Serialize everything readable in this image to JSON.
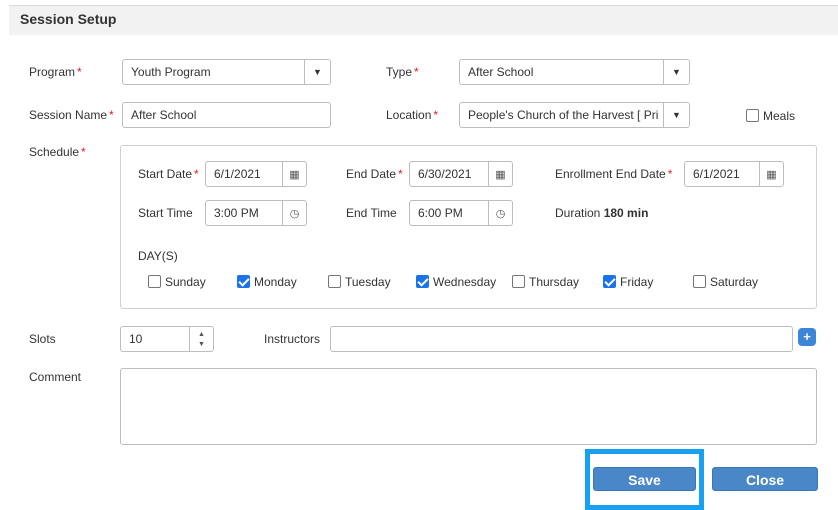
{
  "header": {
    "title": "Session Setup"
  },
  "form": {
    "program": {
      "label": "Program",
      "value": "Youth Program"
    },
    "type": {
      "label": "Type",
      "value": "After School"
    },
    "session_name": {
      "label": "Session Name",
      "value": "After School"
    },
    "location": {
      "label": "Location",
      "value": "People's Church of the Harvest [ Pri"
    },
    "meals": {
      "label": "Meals",
      "checked": false
    },
    "schedule": {
      "label": "Schedule",
      "start_date": {
        "label": "Start Date",
        "value": "6/1/2021"
      },
      "end_date": {
        "label": "End Date",
        "value": "6/30/2021"
      },
      "enrollment_end_date": {
        "label": "Enrollment End Date",
        "value": "6/1/2021"
      },
      "start_time": {
        "label": "Start Time",
        "value": "3:00 PM"
      },
      "end_time": {
        "label": "End Time",
        "value": "6:00 PM"
      },
      "duration": {
        "label": "Duration",
        "value": "180 min"
      },
      "days_label": "DAY(S)",
      "days": [
        {
          "label": "Sunday",
          "checked": false
        },
        {
          "label": "Monday",
          "checked": true
        },
        {
          "label": "Tuesday",
          "checked": false
        },
        {
          "label": "Wednesday",
          "checked": true
        },
        {
          "label": "Thursday",
          "checked": false
        },
        {
          "label": "Friday",
          "checked": true
        },
        {
          "label": "Saturday",
          "checked": false
        }
      ]
    },
    "slots": {
      "label": "Slots",
      "value": "10"
    },
    "instructors": {
      "label": "Instructors",
      "value": ""
    },
    "comment": {
      "label": "Comment",
      "value": ""
    },
    "required_marker": "*"
  },
  "actions": {
    "save_label": "Save",
    "close_label": "Close"
  },
  "icons": {
    "dropdown": "▼",
    "calendar": "▦",
    "clock": "◷",
    "spinner_up": "▲",
    "spinner_down": "▼",
    "add": "+"
  },
  "colors": {
    "accent": "#4a87c9",
    "highlight": "#1aa0f0",
    "required": "#e02020"
  }
}
